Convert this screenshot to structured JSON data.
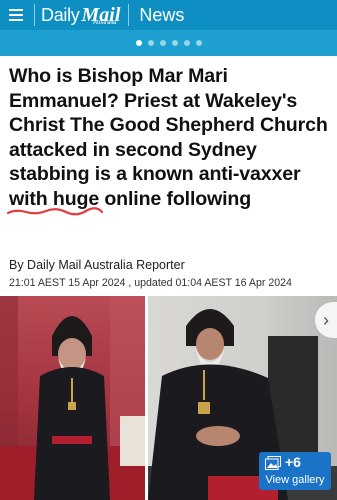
{
  "header": {
    "brand_daily": "Daily",
    "brand_mail": "Mail",
    "brand_sub": "Australia",
    "section": "News",
    "carousel_dots": 6,
    "active_dot": 0
  },
  "article": {
    "headline": "Who is Bishop Mar Mari Emmanuel? Priest at Wakeley's Christ The Good Shepherd Church attacked in second Sydney stabbing is a known anti-vaxxer with huge online following",
    "byline": "By Daily Mail Australia Reporter",
    "timestamp": "21:01 AEST 15 Apr 2024 , updated 01:04 AEST 16 Apr 2024"
  },
  "gallery": {
    "count_label": "+6",
    "button_label": "View gallery",
    "next_icon": "chevron-right-icon"
  },
  "colors": {
    "header_bg": "#0e8fc3",
    "subbar_bg": "#1d9fd0",
    "gallery_button": "#1b73c8",
    "squiggle": "#e8393f"
  }
}
